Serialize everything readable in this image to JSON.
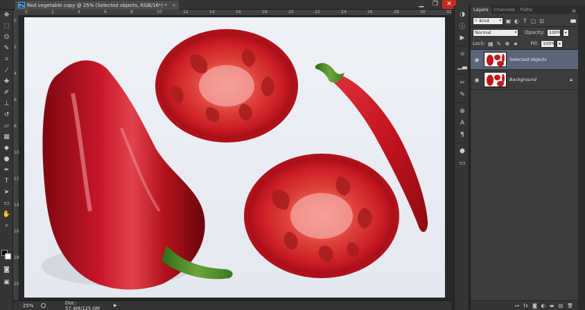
{
  "document": {
    "badge": "Ps",
    "tab_title": "Red vegetable copy @ 25% (Selected objects, RGB/16*) *",
    "close_glyph": "×"
  },
  "window": {
    "minimize": "▁",
    "restore": "❐",
    "close": "✕"
  },
  "rulers": {
    "horizontal": [
      "0",
      "2",
      "4",
      "6",
      "8",
      "10",
      "12",
      "14",
      "16",
      "18",
      "20",
      "22",
      "24",
      "26",
      "28",
      "30",
      "32"
    ],
    "vertical": [
      "0",
      "2",
      "4",
      "6",
      "8",
      "10",
      "12",
      "14",
      "16",
      "18",
      "20"
    ]
  },
  "status": {
    "zoom": "25%",
    "doc_info": "Doc: 57.4M/125.0M",
    "arrow": "▶"
  },
  "layers_panel": {
    "tabs": [
      "Layers",
      "Channels",
      "Paths"
    ],
    "menu_glyph": "≡",
    "filter": {
      "kind_label": "Kind"
    },
    "blend_mode": "Normal",
    "opacity_label": "Opacity:",
    "opacity_value": "100%",
    "lock_label": "Lock:",
    "fill_label": "Fill:",
    "fill_value": "100%",
    "layers": [
      {
        "name": "Selected objects",
        "selected": true
      },
      {
        "name": "Background",
        "selected": false,
        "locked": true
      }
    ],
    "footer_icons": [
      "link-icon",
      "fx-icon",
      "mask-icon",
      "adjustment-icon",
      "group-icon",
      "new-layer-icon",
      "trash-icon"
    ],
    "footer_glyphs": {
      "fx": "fx"
    }
  },
  "colors": {
    "ui_dark": "#282828",
    "panel": "#3c3c3c",
    "selection": "#5a6678",
    "tomato_red": "#d2232a",
    "pepper_red": "#b3121c",
    "stem_green": "#4c8a2a"
  }
}
